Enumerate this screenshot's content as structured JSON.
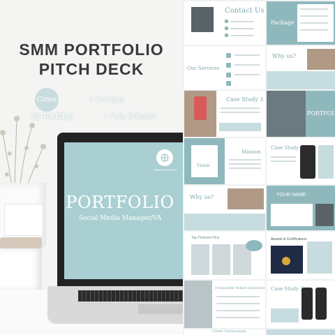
{
  "hero": {
    "title_line1": "SMM PORTFOLIO",
    "title_line2": "PITCH DECK",
    "canva_logo": "Canva",
    "pages": "32 PAGES",
    "bullets": [
      "+ Prompts",
      "+ Fully Editable"
    ],
    "screen_logo_text": "SMM PORTFOLIO",
    "screen_title": "PORTFOLIO",
    "screen_subtitle": "Social Media Manager/VA"
  },
  "slides": {
    "contact": "Contact Us",
    "package": "Package",
    "why_us": "Why us?",
    "our_services": "Our Services",
    "case_study_3": "Case Study 3",
    "portfolio": "PORTFOLIO",
    "vision": "Vision",
    "mission": "Mission",
    "case_study_1": "Case Study 1",
    "why_us_2": "Why us?",
    "your_name": "YOUR NAME",
    "top_posts": "Top Pinterest Pins",
    "awards": "Awards & Certifications",
    "faq": "Frequently Asked Questions",
    "case_study_2": "Case Study 2",
    "client_testimonials": "Client Testimonials"
  },
  "colors": {
    "teal": "#8fb8bd",
    "teal_light": "#c7dcdf",
    "title_dark": "#3a3a3a"
  }
}
